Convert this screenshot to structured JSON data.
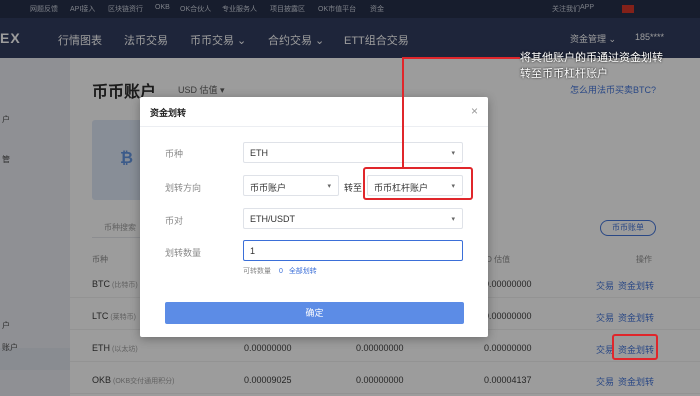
{
  "topbar": {
    "links": [
      "网题反馈",
      "API接入",
      "区块链资行",
      "OKB",
      "OK合伙人",
      "专业服务人",
      "项目披露区",
      "OK市值平台",
      "资金"
    ],
    "follow": "关注我们",
    "app": "APP"
  },
  "navbar": {
    "logo": "EX",
    "items": [
      "行情图表",
      "法币交易",
      "币币交易 ⌄",
      "合约交易 ⌄",
      "ETT组合交易"
    ],
    "asset_mgmt": "资金管理 ⌄",
    "user": "185****"
  },
  "sidebar": {
    "items": [
      "户",
      "管",
      "户",
      "账户"
    ]
  },
  "page": {
    "title": "币币账户",
    "currency": "USD 估值 ▾",
    "help_link": "怎么用法币买卖BTC?",
    "card_symbol": "₿",
    "search_placeholder": "币种搜索",
    "bill_button": "币币账单"
  },
  "table": {
    "headers": {
      "coin": "币种",
      "valuation": "USD 估值",
      "action": "操作"
    },
    "rows": [
      {
        "coin": "BTC",
        "sub": "(比特币)",
        "col1": "",
        "col2": "",
        "valuation": "0.00000000",
        "trade": "交易",
        "transfer": "资金划转"
      },
      {
        "coin": "LTC",
        "sub": "(莱特币)",
        "col1": "",
        "col2": "",
        "valuation": "0.00000000",
        "trade": "交易",
        "transfer": "资金划转"
      },
      {
        "coin": "ETH",
        "sub": "(以太坊)",
        "col1": "0.00000000",
        "col2": "0.00000000",
        "valuation": "0.00000000",
        "trade": "交易",
        "transfer": "资金划转"
      },
      {
        "coin": "OKB",
        "sub": "(OKB交付通用积分)",
        "col1": "0.00009025",
        "col2": "0.00000000",
        "valuation": "0.00004137",
        "trade": "交易",
        "transfer": "资金划转"
      }
    ]
  },
  "modal": {
    "title": "资金划转",
    "close": "×",
    "coin_label": "币种",
    "coin_value": "ETH",
    "direction_label": "划转方向",
    "from_value": "币币账户",
    "to_word": "转至",
    "to_value": "币币杠杆账户",
    "pair_label": "币对",
    "pair_value": "ETH/USDT",
    "amount_label": "划转数量",
    "amount_value": "1",
    "available_label": "可转数量",
    "available_value": "0",
    "all_transfer": "全部划转",
    "confirm": "确定"
  },
  "annotation": {
    "line1": "将其他账户的币通过资金划转",
    "line2": "转至币币杠杆账户"
  },
  "colors": {
    "accent": "#3b6fd8",
    "annotation_red": "#e0262b",
    "nav_bg": "#263257"
  }
}
